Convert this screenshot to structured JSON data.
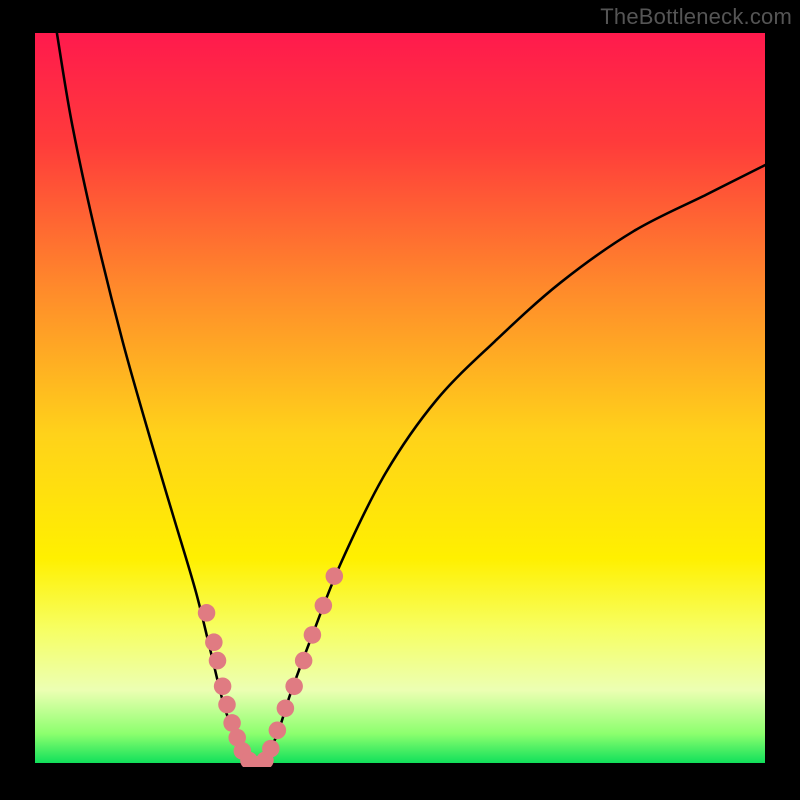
{
  "watermark": "TheBottleneck.com",
  "chart_data": {
    "type": "line",
    "title": "",
    "xlabel": "",
    "ylabel": "",
    "xlim": [
      0,
      100
    ],
    "ylim": [
      0,
      100
    ],
    "gradient_stops": [
      {
        "offset": 0,
        "color": "#ff1a4d"
      },
      {
        "offset": 0.15,
        "color": "#ff3b3b"
      },
      {
        "offset": 0.35,
        "color": "#ff8a2b"
      },
      {
        "offset": 0.55,
        "color": "#ffd21a"
      },
      {
        "offset": 0.72,
        "color": "#fff000"
      },
      {
        "offset": 0.82,
        "color": "#f6ff66"
      },
      {
        "offset": 0.9,
        "color": "#ecffb3"
      },
      {
        "offset": 0.96,
        "color": "#8cff6e"
      },
      {
        "offset": 1.0,
        "color": "#11e05b"
      }
    ],
    "series": [
      {
        "name": "curve",
        "x": [
          3,
          5,
          8,
          12,
          16,
          19,
          22,
          24,
          26,
          28,
          29,
          30,
          31,
          33,
          35,
          38,
          42,
          48,
          55,
          63,
          72,
          82,
          92,
          100
        ],
        "y": [
          100,
          88,
          74,
          58,
          44,
          34,
          24,
          16,
          8,
          3,
          1,
          0,
          1,
          4,
          10,
          18,
          28,
          40,
          50,
          58,
          66,
          73,
          78,
          82
        ]
      }
    ],
    "markers": {
      "name": "dots",
      "color": "#e07b82",
      "radius": 1.2,
      "points": [
        {
          "x": 23.5,
          "y": 21
        },
        {
          "x": 24.5,
          "y": 17
        },
        {
          "x": 25.0,
          "y": 14.5
        },
        {
          "x": 25.7,
          "y": 11
        },
        {
          "x": 26.3,
          "y": 8.5
        },
        {
          "x": 27.0,
          "y": 6
        },
        {
          "x": 27.7,
          "y": 4
        },
        {
          "x": 28.4,
          "y": 2.2
        },
        {
          "x": 29.3,
          "y": 0.9
        },
        {
          "x": 30.5,
          "y": 0.3
        },
        {
          "x": 31.5,
          "y": 0.9
        },
        {
          "x": 32.3,
          "y": 2.5
        },
        {
          "x": 33.2,
          "y": 5
        },
        {
          "x": 34.3,
          "y": 8
        },
        {
          "x": 35.5,
          "y": 11
        },
        {
          "x": 36.8,
          "y": 14.5
        },
        {
          "x": 38.0,
          "y": 18
        },
        {
          "x": 39.5,
          "y": 22
        },
        {
          "x": 41.0,
          "y": 26
        }
      ]
    }
  }
}
